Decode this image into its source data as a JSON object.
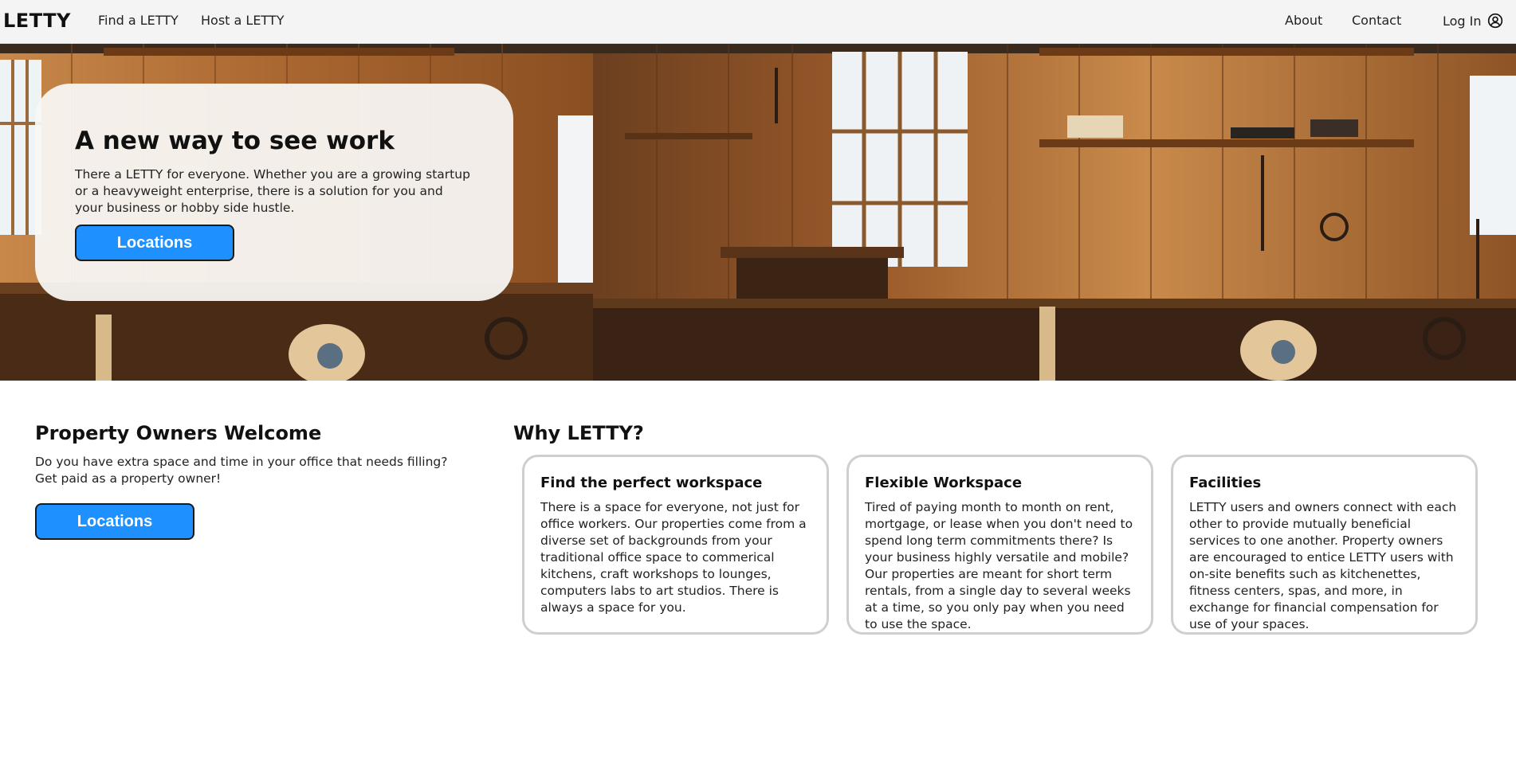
{
  "nav": {
    "brand": "LETTY",
    "links": [
      "Find a LETTY",
      "Host a LETTY",
      "About",
      "Contact"
    ],
    "login_label": "Log In",
    "login_icon": "user-circle-icon"
  },
  "hero": {
    "image": "workshop-photo",
    "title": "A new way to see work",
    "text": "There a LETTY for everyone. Whether you are a growing startup or a heavyweight enterprise, there is a solution for you and your business or hobby side hustle.",
    "button_label": "Locations"
  },
  "owners": {
    "title": "Property Owners Welcome",
    "text": "Do you have extra space and time in your office that needs filling? Get paid as a property owner!",
    "button_label": "Locations"
  },
  "why": {
    "title": "Why LETTY?",
    "cards": [
      {
        "title": "Find the perfect workspace",
        "text": "There is a space for everyone, not just for office workers. Our properties come from a diverse set of backgrounds from your traditional office space to commerical kitchens, craft workshops to lounges, computers labs to art studios. There is always a space for you."
      },
      {
        "title": "Flexible Workspace",
        "text": "Tired of paying month to month on rent, mortgage, or lease when you don't need to spend long term commitments there? Is your business highly versatile and mobile? Our properties are meant for short term rentals, from a single day to several weeks at a time, so you only pay when you need to use the space."
      },
      {
        "title": "Facilities",
        "text": "LETTY users and owners connect with each other to provide mutually beneficial services to one another. Property owners are encouraged to entice LETTY users with on-site benefits such as kitchenettes, fitness centers, spas, and more, in exchange for financial compensation for use of your spaces."
      }
    ]
  },
  "colors": {
    "accent": "#1e90ff",
    "navbar_bg": "#f4f4f4",
    "card_border": "#cfcfcf"
  }
}
